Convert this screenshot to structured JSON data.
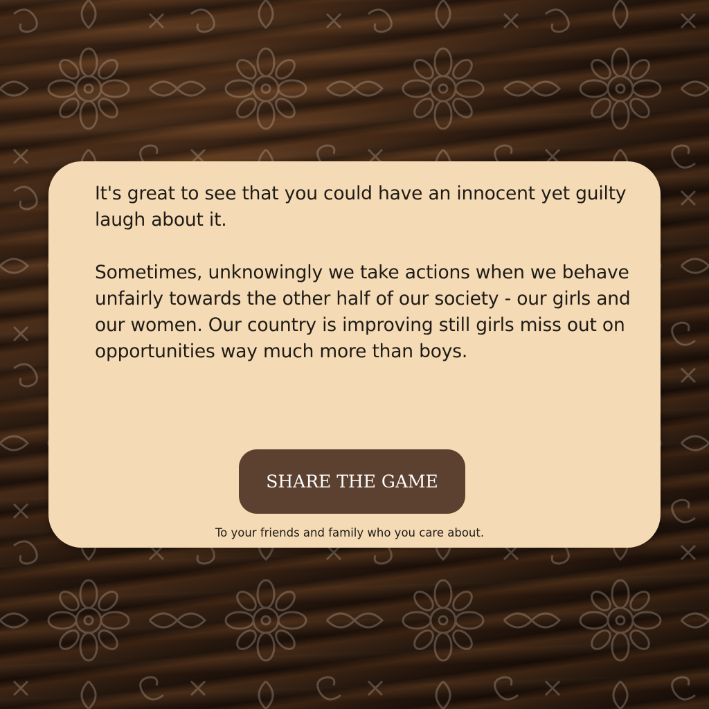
{
  "result_card": {
    "paragraph_1": "It's great to see that you could have an innocent yet guilty laugh about it.",
    "paragraph_2": "Sometimes, unknowingly we take actions when we behave unfairly towards the other half of our society - our girls and our women. Our country is improving still girls miss out on opportunities way much more than boys.",
    "share_button_label": "SHARE THE GAME",
    "share_caption": "To your friends and family who you care about."
  },
  "colors": {
    "card_background": "#f5dbb5",
    "button_background": "#5c4030",
    "text": "#1e1a16",
    "page_background": "#2a1b11"
  },
  "icons": {
    "background_motif": "mandala-pattern-icon"
  }
}
